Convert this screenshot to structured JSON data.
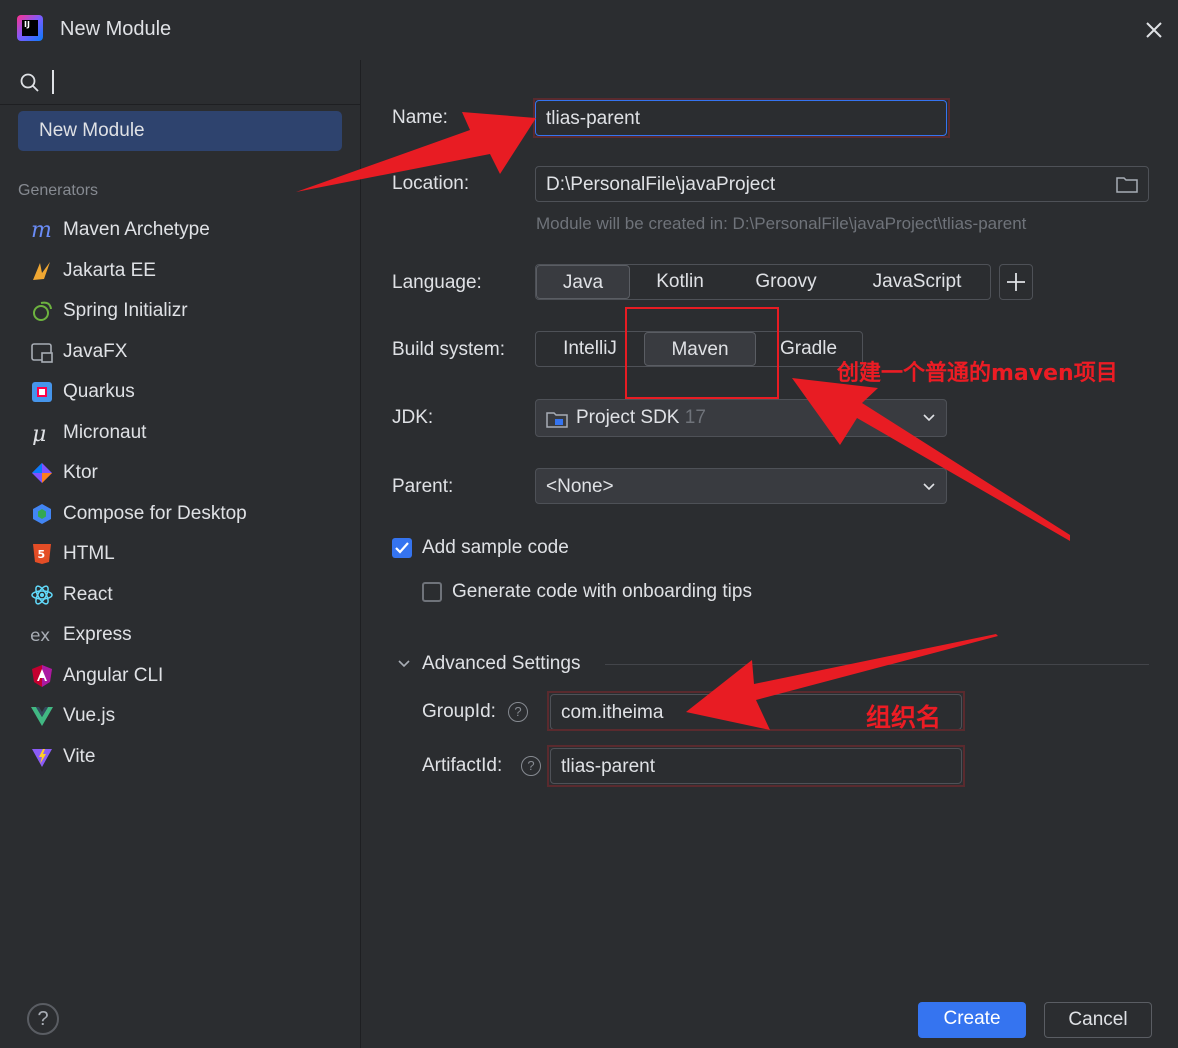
{
  "window": {
    "title": "New Module"
  },
  "sidebar": {
    "selected": "New Module",
    "section_label": "Generators",
    "items": [
      {
        "label": "Maven Archetype",
        "icon": "maven-icon"
      },
      {
        "label": "Jakarta EE",
        "icon": "jakarta-ee-icon"
      },
      {
        "label": "Spring Initializr",
        "icon": "spring-icon"
      },
      {
        "label": "JavaFX",
        "icon": "javafx-icon"
      },
      {
        "label": "Quarkus",
        "icon": "quarkus-icon"
      },
      {
        "label": "Micronaut",
        "icon": "micronaut-icon"
      },
      {
        "label": "Ktor",
        "icon": "ktor-icon"
      },
      {
        "label": "Compose for Desktop",
        "icon": "compose-icon"
      },
      {
        "label": "HTML",
        "icon": "html5-icon"
      },
      {
        "label": "React",
        "icon": "react-icon"
      },
      {
        "label": "Express",
        "icon": "express-icon"
      },
      {
        "label": "Angular CLI",
        "icon": "angular-icon"
      },
      {
        "label": "Vue.js",
        "icon": "vue-icon"
      },
      {
        "label": "Vite",
        "icon": "vite-icon"
      }
    ]
  },
  "form": {
    "name_label": "Name:",
    "name_value": "tlias-parent",
    "location_label": "Location:",
    "location_value": "D:\\PersonalFile\\javaProject",
    "location_hint": "Module will be created in: D:\\PersonalFile\\javaProject\\tlias-parent",
    "language_label": "Language:",
    "languages": [
      "Java",
      "Kotlin",
      "Groovy",
      "JavaScript"
    ],
    "language_selected": "Java",
    "build_label": "Build system:",
    "build_systems": [
      "IntelliJ",
      "Maven",
      "Gradle"
    ],
    "build_selected": "Maven",
    "jdk_label": "JDK:",
    "jdk_value": "Project SDK",
    "jdk_version": "17",
    "parent_label": "Parent:",
    "parent_value": "<None>",
    "sample_code_label": "Add sample code",
    "sample_code_checked": true,
    "onboarding_label": "Generate code with onboarding tips",
    "onboarding_checked": false,
    "advanced_label": "Advanced Settings",
    "groupid_label": "GroupId:",
    "groupid_value": "com.itheima",
    "artifactid_label": "ArtifactId:",
    "artifactid_value": "tlias-parent"
  },
  "annotations": {
    "maven_note": "创建一个普通的maven项目",
    "group_note": "组织名"
  },
  "buttons": {
    "create": "Create",
    "cancel": "Cancel",
    "help": "?"
  },
  "colors": {
    "accent": "#3574f0",
    "annotation": "#ec1c24",
    "background": "#2b2d30"
  }
}
